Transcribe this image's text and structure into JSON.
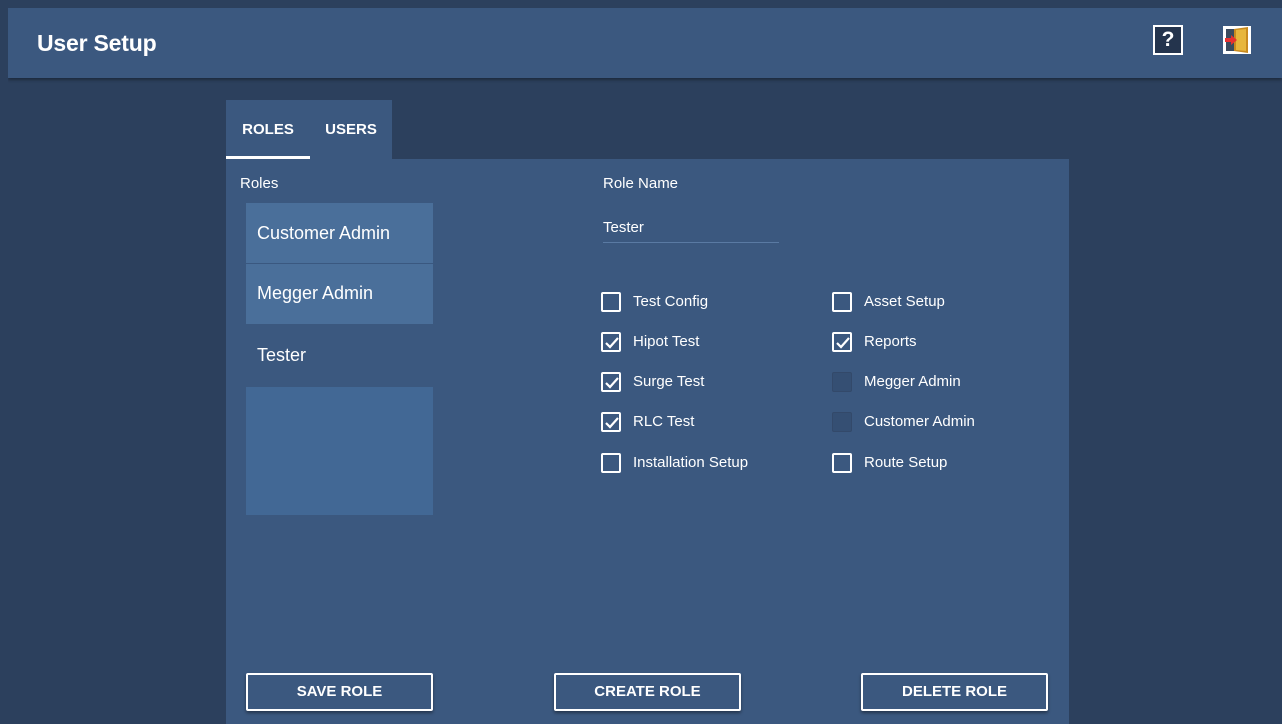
{
  "header": {
    "title": "User Setup",
    "help_glyph": "?",
    "help_icon": "help-icon",
    "exit_icon": "exit-door-icon"
  },
  "tabs": [
    {
      "label": "ROLES",
      "active": true
    },
    {
      "label": "USERS",
      "active": false
    }
  ],
  "roles_panel": {
    "label": "Roles",
    "items": [
      {
        "label": "Customer Admin",
        "selected": false
      },
      {
        "label": "Megger Admin",
        "selected": false
      },
      {
        "label": "Tester",
        "selected": true
      }
    ]
  },
  "role_form": {
    "label": "Role Name",
    "value": "Tester"
  },
  "permissions": {
    "left": [
      {
        "label": "Test Config",
        "checked": false,
        "enabled": true
      },
      {
        "label": "Hipot Test",
        "checked": true,
        "enabled": true
      },
      {
        "label": "Surge Test",
        "checked": true,
        "enabled": true
      },
      {
        "label": "RLC Test",
        "checked": true,
        "enabled": true
      },
      {
        "label": "Installation Setup",
        "checked": false,
        "enabled": true
      }
    ],
    "right": [
      {
        "label": "Asset Setup",
        "checked": false,
        "enabled": true
      },
      {
        "label": "Reports",
        "checked": true,
        "enabled": true
      },
      {
        "label": "Megger Admin",
        "checked": false,
        "enabled": false
      },
      {
        "label": "Customer Admin",
        "checked": false,
        "enabled": false
      },
      {
        "label": "Route Setup",
        "checked": false,
        "enabled": true
      }
    ]
  },
  "buttons": {
    "save": "SAVE ROLE",
    "create": "CREATE ROLE",
    "delete": "DELETE ROLE"
  },
  "colors": {
    "header_bg": "#3b587f",
    "page_bg": "#2c405d",
    "panel_bg": "#3b587f",
    "list_item_bg": "#4a6f9a",
    "exit_icon_accent": "#e8312f"
  }
}
